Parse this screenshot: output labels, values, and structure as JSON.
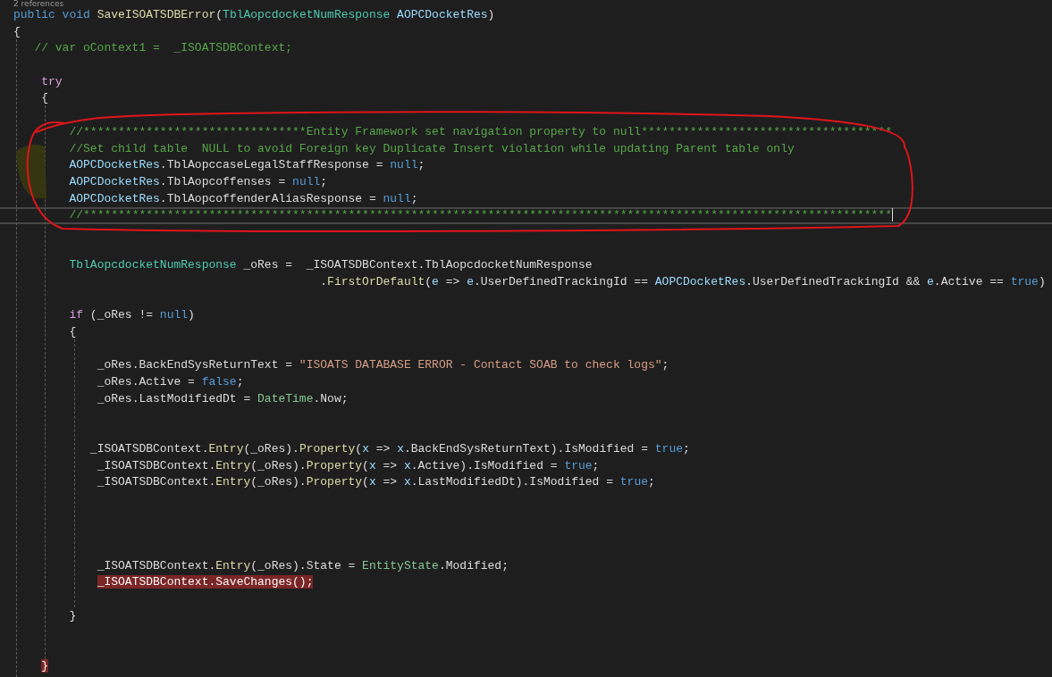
{
  "code_lens": "2 references",
  "lines": [
    {
      "kind": "code",
      "current": false,
      "highlighted": false,
      "tokens": [
        {
          "kind": "kw",
          "text": "public void"
        },
        {
          "kind": "fn",
          "text": " SaveISOATSDBError"
        },
        {
          "kind": "plain",
          "text": "("
        },
        {
          "kind": "type",
          "text": "TblAopcdocketNumResponse"
        },
        {
          "kind": "param",
          "text": " AOPCDocketRes"
        },
        {
          "kind": "plain",
          "text": ")"
        }
      ]
    },
    {
      "kind": "code",
      "current": false,
      "highlighted": false,
      "tokens": [
        {
          "kind": "plain",
          "text": "{"
        }
      ]
    },
    {
      "kind": "code",
      "current": false,
      "highlighted": false,
      "tokens": [
        {
          "kind": "comment",
          "text": "   // var oContext1 =  _ISOATSDBContext;"
        }
      ]
    },
    {
      "kind": "blank"
    },
    {
      "kind": "code",
      "current": false,
      "highlighted": false,
      "tokens": [
        {
          "kind": "ctl",
          "text": "    try"
        }
      ]
    },
    {
      "kind": "code",
      "current": false,
      "highlighted": false,
      "tokens": [
        {
          "kind": "plain",
          "text": "    {"
        }
      ]
    },
    {
      "kind": "blank"
    },
    {
      "kind": "code",
      "current": false,
      "highlighted": false,
      "tokens": [
        {
          "kind": "comment",
          "text": "        //********************************Entity Framework set navigation property to null************************************"
        }
      ]
    },
    {
      "kind": "code",
      "current": false,
      "highlighted": false,
      "tokens": [
        {
          "kind": "comment",
          "text": "        //Set child table  NULL to avoid Foreign key Duplicate Insert violation while updating Parent table only"
        }
      ]
    },
    {
      "kind": "code",
      "current": false,
      "highlighted": false,
      "tokens": [
        {
          "kind": "param",
          "text": "        AOPCDocketRes"
        },
        {
          "kind": "plain",
          "text": ".TblAopccaseLegalStaffResponse ="
        },
        {
          "kind": "kw",
          "text": " null"
        },
        {
          "kind": "plain",
          "text": ";"
        }
      ]
    },
    {
      "kind": "code",
      "current": false,
      "highlighted": false,
      "tokens": [
        {
          "kind": "param",
          "text": "        AOPCDocketRes"
        },
        {
          "kind": "plain",
          "text": ".TblAopcoffenses ="
        },
        {
          "kind": "kw",
          "text": " null"
        },
        {
          "kind": "plain",
          "text": ";"
        }
      ]
    },
    {
      "kind": "code",
      "current": false,
      "highlighted": false,
      "tokens": [
        {
          "kind": "param",
          "text": "        AOPCDocketRes"
        },
        {
          "kind": "plain",
          "text": ".TblAopcoffenderAliasResponse ="
        },
        {
          "kind": "kw",
          "text": " null"
        },
        {
          "kind": "plain",
          "text": ";"
        }
      ]
    },
    {
      "kind": "code",
      "current": true,
      "highlighted": false,
      "tokens": [
        {
          "kind": "comment",
          "text": "        //********************************************************************************************************************"
        }
      ]
    },
    {
      "kind": "blank"
    },
    {
      "kind": "blank"
    },
    {
      "kind": "code",
      "current": false,
      "highlighted": false,
      "tokens": [
        {
          "kind": "type",
          "text": "        TblAopcdocketNumResponse"
        },
        {
          "kind": "plain",
          "text": " _oRes =  _ISOATSDBContext.TblAopcdocketNumResponse"
        }
      ]
    },
    {
      "kind": "code",
      "current": false,
      "highlighted": false,
      "tokens": [
        {
          "kind": "plain",
          "text": "                                            ."
        },
        {
          "kind": "fn",
          "text": "FirstOrDefault"
        },
        {
          "kind": "plain",
          "text": "("
        },
        {
          "kind": "param",
          "text": "e"
        },
        {
          "kind": "plain",
          "text": " =>"
        },
        {
          "kind": "param",
          "text": " e"
        },
        {
          "kind": "plain",
          "text": ".UserDefinedTrackingId =="
        },
        {
          "kind": "param",
          "text": " AOPCDocketRes"
        },
        {
          "kind": "plain",
          "text": ".UserDefinedTrackingId &&"
        },
        {
          "kind": "param",
          "text": " e"
        },
        {
          "kind": "plain",
          "text": ".Active =="
        },
        {
          "kind": "kw",
          "text": " true"
        },
        {
          "kind": "plain",
          "text": ")"
        }
      ]
    },
    {
      "kind": "blank"
    },
    {
      "kind": "code",
      "current": false,
      "highlighted": false,
      "tokens": [
        {
          "kind": "ctl",
          "text": "        if"
        },
        {
          "kind": "plain",
          "text": " (_oRes !="
        },
        {
          "kind": "kw",
          "text": " null"
        },
        {
          "kind": "plain",
          "text": ")"
        }
      ]
    },
    {
      "kind": "code",
      "current": false,
      "highlighted": false,
      "tokens": [
        {
          "kind": "plain",
          "text": "        {"
        }
      ]
    },
    {
      "kind": "blank"
    },
    {
      "kind": "code",
      "current": false,
      "highlighted": false,
      "tokens": [
        {
          "kind": "plain",
          "text": "            _oRes.BackEndSysReturnText ="
        },
        {
          "kind": "string",
          "text": " \"ISOATS DATABASE ERROR - Contact SOAB to check logs\""
        },
        {
          "kind": "plain",
          "text": ";"
        }
      ]
    },
    {
      "kind": "code",
      "current": false,
      "highlighted": false,
      "tokens": [
        {
          "kind": "plain",
          "text": "            _oRes.Active ="
        },
        {
          "kind": "kw",
          "text": " false"
        },
        {
          "kind": "plain",
          "text": ";"
        }
      ]
    },
    {
      "kind": "code",
      "current": false,
      "highlighted": false,
      "tokens": [
        {
          "kind": "plain",
          "text": "            _oRes.LastModifiedDt ="
        },
        {
          "kind": "struct",
          "text": " DateTime"
        },
        {
          "kind": "plain",
          "text": ".Now;"
        }
      ]
    },
    {
      "kind": "blank"
    },
    {
      "kind": "blank"
    },
    {
      "kind": "code",
      "current": false,
      "highlighted": false,
      "tokens": [
        {
          "kind": "plain",
          "text": "           _ISOATSDBContext."
        },
        {
          "kind": "fn",
          "text": "Entry"
        },
        {
          "kind": "plain",
          "text": "(_oRes)."
        },
        {
          "kind": "fn",
          "text": "Property"
        },
        {
          "kind": "plain",
          "text": "("
        },
        {
          "kind": "param",
          "text": "x"
        },
        {
          "kind": "plain",
          "text": " =>"
        },
        {
          "kind": "param",
          "text": " x"
        },
        {
          "kind": "plain",
          "text": ".BackEndSysReturnText).IsModified ="
        },
        {
          "kind": "kw",
          "text": " true"
        },
        {
          "kind": "plain",
          "text": ";"
        }
      ]
    },
    {
      "kind": "code",
      "current": false,
      "highlighted": false,
      "tokens": [
        {
          "kind": "plain",
          "text": "            _ISOATSDBContext."
        },
        {
          "kind": "fn",
          "text": "Entry"
        },
        {
          "kind": "plain",
          "text": "(_oRes)."
        },
        {
          "kind": "fn",
          "text": "Property"
        },
        {
          "kind": "plain",
          "text": "("
        },
        {
          "kind": "param",
          "text": "x"
        },
        {
          "kind": "plain",
          "text": " =>"
        },
        {
          "kind": "param",
          "text": " x"
        },
        {
          "kind": "plain",
          "text": ".Active).IsModified ="
        },
        {
          "kind": "kw",
          "text": " true"
        },
        {
          "kind": "plain",
          "text": ";"
        }
      ]
    },
    {
      "kind": "code",
      "current": false,
      "highlighted": false,
      "tokens": [
        {
          "kind": "plain",
          "text": "            _ISOATSDBContext."
        },
        {
          "kind": "fn",
          "text": "Entry"
        },
        {
          "kind": "plain",
          "text": "(_oRes)."
        },
        {
          "kind": "fn",
          "text": "Property"
        },
        {
          "kind": "plain",
          "text": "("
        },
        {
          "kind": "param",
          "text": "x"
        },
        {
          "kind": "plain",
          "text": " =>"
        },
        {
          "kind": "param",
          "text": " x"
        },
        {
          "kind": "plain",
          "text": ".LastModifiedDt).IsModified ="
        },
        {
          "kind": "kw",
          "text": " true"
        },
        {
          "kind": "plain",
          "text": ";"
        }
      ]
    },
    {
      "kind": "blank"
    },
    {
      "kind": "blank"
    },
    {
      "kind": "blank"
    },
    {
      "kind": "blank"
    },
    {
      "kind": "code",
      "current": false,
      "highlighted": false,
      "tokens": [
        {
          "kind": "plain",
          "text": "            _ISOATSDBContext."
        },
        {
          "kind": "fn",
          "text": "Entry"
        },
        {
          "kind": "plain",
          "text": "(_oRes).State ="
        },
        {
          "kind": "struct",
          "text": " EntityState"
        },
        {
          "kind": "plain",
          "text": ".Modified;"
        }
      ]
    },
    {
      "kind": "code",
      "current": false,
      "highlighted": true,
      "tokens": [
        {
          "kind": "plain",
          "text": "            _ISOATSDBContext.SaveChanges();"
        }
      ]
    },
    {
      "kind": "blank"
    },
    {
      "kind": "code",
      "current": false,
      "highlighted": false,
      "tokens": [
        {
          "kind": "plain",
          "text": "        }"
        }
      ]
    },
    {
      "kind": "blank"
    },
    {
      "kind": "blank"
    },
    {
      "kind": "code",
      "current": false,
      "highlighted": true,
      "tokens": [
        {
          "kind": "plain",
          "text": "    }"
        }
      ]
    }
  ]
}
